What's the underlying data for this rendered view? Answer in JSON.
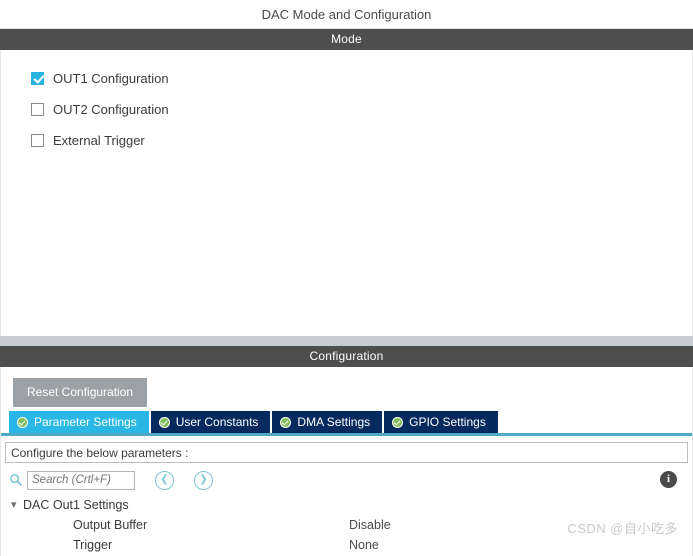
{
  "window": {
    "title": "DAC Mode and Configuration"
  },
  "mode_section": {
    "header": "Mode",
    "options": [
      {
        "label": "OUT1 Configuration",
        "checked": true
      },
      {
        "label": "OUT2 Configuration",
        "checked": false
      },
      {
        "label": "External Trigger",
        "checked": false
      }
    ]
  },
  "configuration_section": {
    "header": "Configuration",
    "reset_button": "Reset Configuration",
    "tabs": [
      {
        "label": "Parameter Settings",
        "icon": "green-check-icon",
        "active": true
      },
      {
        "label": "User Constants",
        "icon": "green-check-icon",
        "active": false
      },
      {
        "label": "DMA Settings",
        "icon": "green-check-icon",
        "active": false
      },
      {
        "label": "GPIO Settings",
        "icon": "green-check-icon",
        "active": false
      }
    ],
    "configure_hint": "Configure the below parameters :",
    "search": {
      "placeholder": "Search (Crtl+F)",
      "value": "",
      "icon": "search-icon",
      "prev_icon": "chevron-left-icon",
      "next_icon": "chevron-right-icon"
    },
    "info_icon_label": "i",
    "parameters": {
      "group_label": "DAC Out1 Settings",
      "expanded": true,
      "rows": [
        {
          "name": "Output Buffer",
          "value": "Disable"
        },
        {
          "name": "Trigger",
          "value": "None"
        }
      ]
    }
  },
  "watermark": "CSDN @自小吃多",
  "colors": {
    "section_bar": "#4e4e4e",
    "accent_cyan": "#29b8e5",
    "tab_inactive": "#062a5e",
    "tab_underline": "#4fa9c4",
    "reset_button": "#9ba1a5",
    "band": "#c6cdd0",
    "icon_green": "#7fbf5a"
  }
}
